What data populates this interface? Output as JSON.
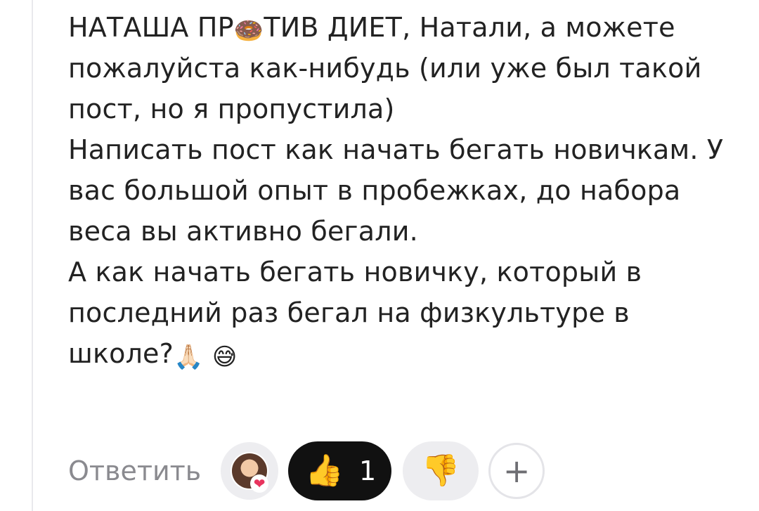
{
  "comment": {
    "mention": "НАТАША ПР",
    "mention_emoji": "🍩",
    "mention_rest": "ТИВ ДИЕТ",
    "text_part1": ", Натали, а можете пожалуйста как-нибудь (или уже был такой пост, но я пропустила)\nНаписать пост как начать бегать новичкам. У вас большой опыт в пробежках, до набора веса вы активно бегали.\nА как начать бегать новичку, который в последний раз бегал на физкультуре в школе?",
    "emoji_pray": "🙏🏻",
    "emoji_smile": "😅"
  },
  "actions": {
    "reply_label": "Ответить",
    "reaction_avatar_icon": "avatar-with-heart",
    "heart_glyph": "❤",
    "like_emoji": "👍",
    "like_count": "1",
    "dislike_emoji": "👎",
    "add_glyph": "+"
  },
  "colors": {
    "like_pill_bg": "#111111",
    "pill_bg": "#ededf0",
    "reply_color": "#8a8a8f",
    "heart_color": "#e8345e"
  }
}
